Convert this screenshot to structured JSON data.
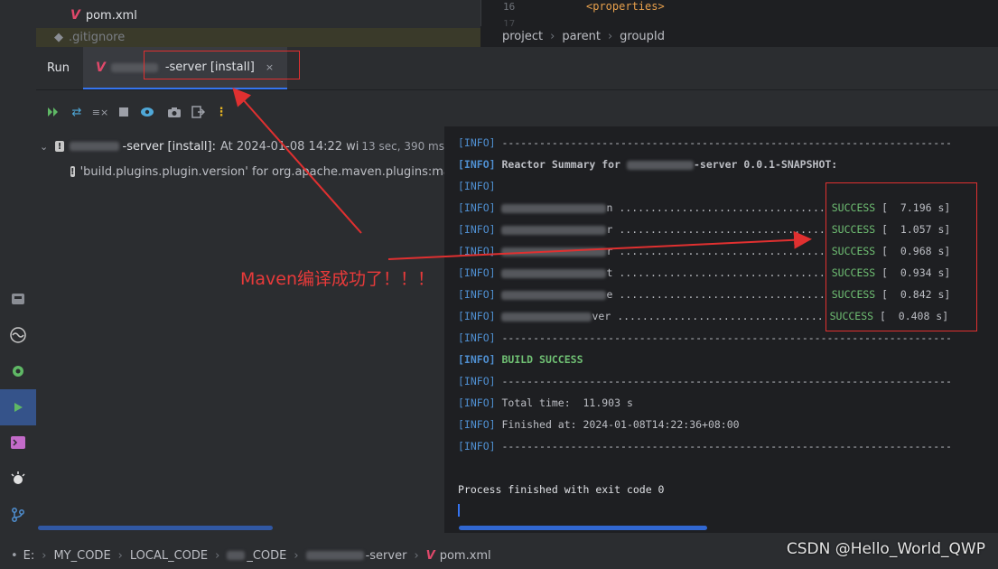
{
  "project": {
    "pom_file": "pom.xml",
    "gitignore_file": ".gitignore"
  },
  "editor": {
    "line_numbers": [
      "16",
      "17"
    ],
    "code_line": "<properties>",
    "breadcrumb": [
      "project",
      "parent",
      "groupId"
    ]
  },
  "run": {
    "label": "Run",
    "tab_title": "-server [install]",
    "tab_close": "×",
    "tree": [
      {
        "title": "-server [install]:",
        "detail": "At 2024-01-08 14:22 wi",
        "duration": "13 sec, 390 ms"
      },
      {
        "title": "'build.plugins.plugin.version' for org.apache.maven.plugins:mav"
      }
    ]
  },
  "console": {
    "tag": "[INFO]",
    "separator": "------------------------------------------------------------------------",
    "reactor_summary_prefix": "Reactor Summary for",
    "reactor_summary_suffix": "-server 0.0.1-SNAPSHOT:",
    "modules": [
      {
        "name_end": "n",
        "status": "SUCCESS",
        "time": "[  7.196 s]"
      },
      {
        "name_end": "r",
        "status": "SUCCESS",
        "time": "[  1.057 s]"
      },
      {
        "name_end": "r",
        "status": "SUCCESS",
        "time": "[  0.968 s]"
      },
      {
        "name_end": "t",
        "status": "SUCCESS",
        "time": "[  0.934 s]"
      },
      {
        "name_end": "e",
        "status": "SUCCESS",
        "time": "[  0.842 s]"
      },
      {
        "name_end": "ver",
        "status": "SUCCESS",
        "time": "[  0.408 s]"
      }
    ],
    "build_success": "BUILD SUCCESS",
    "total_time": "Total time:  11.903 s",
    "finished_at": "Finished at: 2024-01-08T14:22:36+08:00",
    "process_finished": "Process finished with exit code 0"
  },
  "annotation": {
    "text": "Maven编译成功了！！！"
  },
  "statusbar": {
    "path": [
      "E:",
      "MY_CODE",
      "LOCAL_CODE",
      "_CODE",
      "-server",
      "pom.xml"
    ]
  },
  "watermark": "CSDN @Hello_World_QWP",
  "colors": {
    "accent": "#3574f0",
    "success": "#6fbf73",
    "info_tag": "#4f8fd1",
    "annotation_red": "#e03030"
  }
}
